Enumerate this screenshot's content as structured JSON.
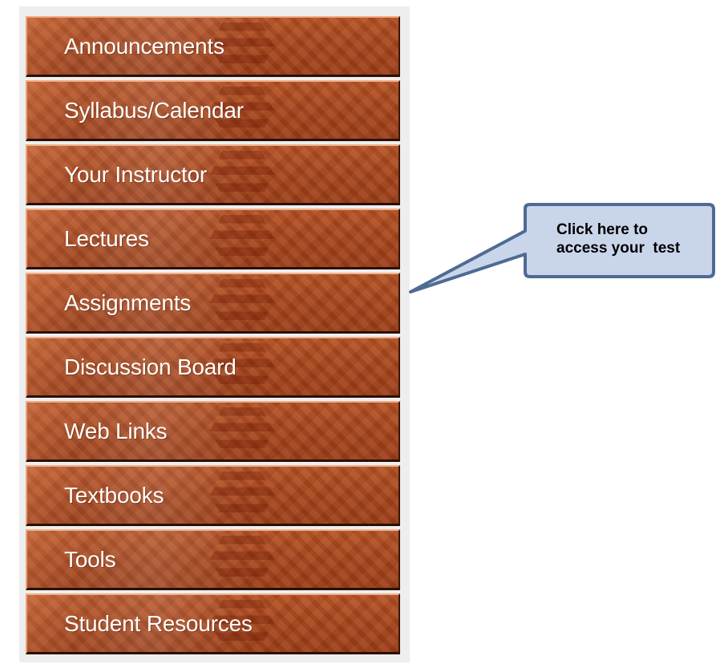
{
  "nav": {
    "items": [
      {
        "label": "Announcements"
      },
      {
        "label": "Syllabus/Calendar"
      },
      {
        "label": "Your Instructor"
      },
      {
        "label": "Lectures"
      },
      {
        "label": "Assignments"
      },
      {
        "label": "Discussion Board"
      },
      {
        "label": "Web Links"
      },
      {
        "label": "Textbooks"
      },
      {
        "label": "Tools"
      },
      {
        "label": "Student Resources"
      }
    ]
  },
  "callout": {
    "line1": "Click here to",
    "line2": "access your  test"
  },
  "colors": {
    "button_base": "#a7481f",
    "panel_bg": "#eeeeee",
    "callout_fill": "#c9d6ea",
    "callout_border": "#4e6b93"
  }
}
